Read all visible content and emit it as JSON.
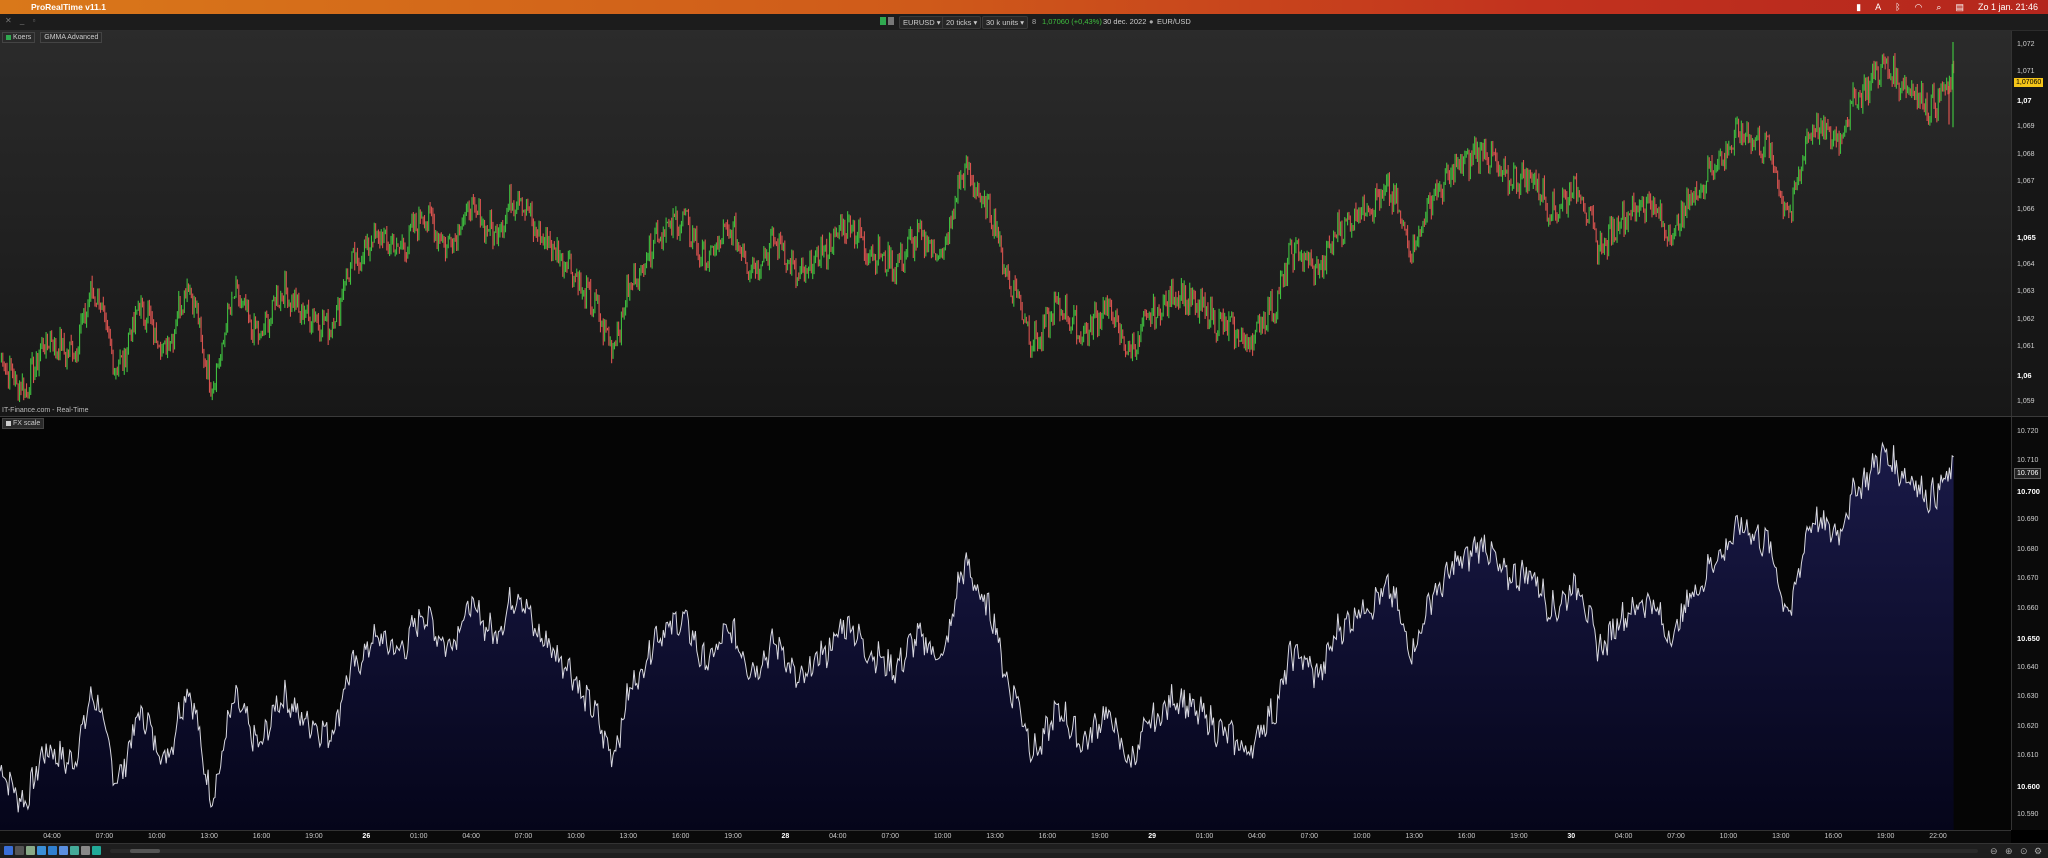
{
  "menubar": {
    "app_title": "ProRealTime v11.1",
    "clock": "Zo 1 jan.  21:46"
  },
  "toolbar": {
    "symbol": "EURUSD",
    "ticks": "20 ticks",
    "units": "30 k units",
    "price_info": "1,07060 (+0,43%)",
    "date": "30 dec. 2022",
    "pair": "EUR/USD",
    "indicator_marker": "8"
  },
  "price_panel": {
    "legend": [
      "Koers",
      "GMMA Advanced"
    ],
    "source": "IT-Finance.com - Real-Time",
    "y_ticks": [
      "1,072",
      "1,071",
      "1,07",
      "1,069",
      "1,068",
      "1,067",
      "1,066",
      "1,065",
      "1,064",
      "1,063",
      "1,062",
      "1,061",
      "1,06",
      "1,059"
    ],
    "last_price_tag": "1,07060"
  },
  "fx_panel": {
    "legend": "FX scale",
    "y_ticks": [
      "10.720",
      "10.710",
      "10.700",
      "10.690",
      "10.680",
      "10.670",
      "10.660",
      "10.650",
      "10.640",
      "10.630",
      "10.620",
      "10.610",
      "10.600",
      "10.590"
    ],
    "last_value_tag": "10.706"
  },
  "x_axis": [
    "04:00",
    "07:00",
    "10:00",
    "13:00",
    "16:00",
    "19:00",
    "26",
    "01:00",
    "04:00",
    "07:00",
    "10:00",
    "13:00",
    "16:00",
    "19:00",
    "28",
    "04:00",
    "07:00",
    "10:00",
    "13:00",
    "16:00",
    "19:00",
    "29",
    "01:00",
    "04:00",
    "07:00",
    "10:00",
    "13:00",
    "16:00",
    "19:00",
    "30",
    "04:00",
    "07:00",
    "10:00",
    "13:00",
    "16:00",
    "19:00",
    "22:00"
  ],
  "colors": {
    "up": "#3fbf3f",
    "down": "#d9534f",
    "fx_line": "#d8d8e0",
    "fx_fill": "#14143a",
    "price_tag": "#f5c518"
  },
  "chart_data": [
    {
      "type": "line",
      "name": "EURUSD price (20 ticks)",
      "y_range": [
        1.0585,
        1.0725
      ],
      "keypoints": [
        1.0605,
        1.0595,
        1.0612,
        1.0608,
        1.063,
        1.0603,
        1.0624,
        1.061,
        1.0632,
        1.0598,
        1.0628,
        1.0614,
        1.063,
        1.0622,
        1.0618,
        1.064,
        1.065,
        1.0646,
        1.0658,
        1.0648,
        1.066,
        1.0652,
        1.0665,
        1.065,
        1.0642,
        1.0628,
        1.0612,
        1.0636,
        1.0652,
        1.0656,
        1.0642,
        1.0652,
        1.064,
        1.0648,
        1.0635,
        1.0645,
        1.0655,
        1.0645,
        1.064,
        1.065,
        1.0644,
        1.0674,
        1.066,
        1.0632,
        1.0612,
        1.0625,
        1.0615,
        1.0624,
        1.0609,
        1.0622,
        1.063,
        1.0624,
        1.0618,
        1.0612,
        1.0624,
        1.0645,
        1.0638,
        1.0654,
        1.0661,
        1.0666,
        1.0647,
        1.0666,
        1.0676,
        1.0682,
        1.0671,
        1.0672,
        1.066,
        1.0668,
        1.0647,
        1.0658,
        1.0663,
        1.0651,
        1.0666,
        1.0678,
        1.0688,
        1.0683,
        1.066,
        1.069,
        1.0686,
        1.0702,
        1.0712,
        1.0705,
        1.0698,
        1.0706
      ],
      "spike_high": 1.0721,
      "spike_low": 1.069
    },
    {
      "type": "area",
      "name": "FX scale",
      "y_range": [
        10.585,
        10.725
      ],
      "note_mirrors_price": true
    }
  ]
}
